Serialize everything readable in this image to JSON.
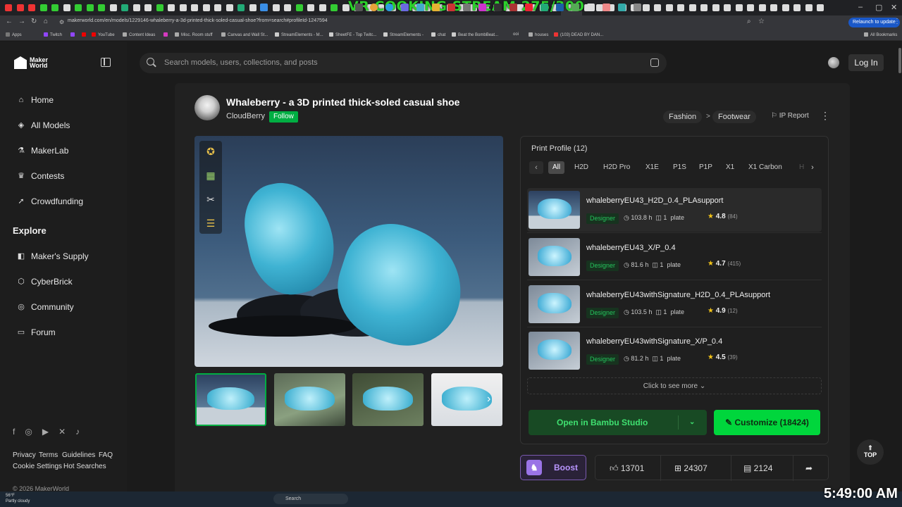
{
  "browser": {
    "stream_overlay": "VR COOKING STREAM 275/300",
    "url": "makerworld.com/en/models/1229146-whaleberry-a-3d-printed-thick-soled-casual-shoe?from=search#profileId-1247594",
    "relaunch_label": "Relaunch to update",
    "bookmarks": [
      "Apps",
      "Twitch",
      "YouTube",
      "Content Ideas",
      "Misc. Room stuff",
      "Canvas and Wall St...",
      "StreamElements - M...",
      "SheetFE - Top Twitc...",
      "StreamElements -",
      "chat",
      "Beat the BombBeat...",
      "ooi",
      "houses",
      "(103) DEAD BY DAN...",
      "All Bookmarks"
    ]
  },
  "sidebar": {
    "logo_line1": "Maker",
    "logo_line2": "World",
    "items": [
      {
        "label": "Home",
        "icon": "home-icon"
      },
      {
        "label": "All Models",
        "icon": "models-icon"
      },
      {
        "label": "MakerLab",
        "icon": "lab-icon"
      },
      {
        "label": "Contests",
        "icon": "trophy-icon"
      },
      {
        "label": "Crowdfunding",
        "icon": "rocket-icon"
      }
    ],
    "explore_heading": "Explore",
    "explore_items": [
      {
        "label": "Maker's Supply",
        "icon": "shopping-bag-icon"
      },
      {
        "label": "CyberBrick",
        "icon": "brick-icon"
      },
      {
        "label": "Community",
        "icon": "globe-icon"
      },
      {
        "label": "Forum",
        "icon": "forum-icon"
      }
    ],
    "footer_links": [
      "Privacy",
      "Terms",
      "Guidelines",
      "FAQ",
      "Cookie Settings",
      "Hot Searches"
    ],
    "copyright": "© 2026 MakerWorld"
  },
  "header": {
    "search_placeholder": "Search models, users, collections, and posts",
    "login_label": "Log In"
  },
  "model": {
    "title": "Whaleberry - a 3D printed thick-soled casual shoe",
    "author": "CloudBerry",
    "follow_label": "Follow",
    "breadcrumb": [
      "Fashion",
      "Footwear"
    ],
    "breadcrumb_separator": ">",
    "ip_report_label": "IP Report"
  },
  "print_profile": {
    "title": "Print Profile (12)",
    "chips": [
      "All",
      "H2D",
      "H2D Pro",
      "X1E",
      "P1S",
      "P1P",
      "X1",
      "X1 Carbon",
      "H"
    ],
    "profiles": [
      {
        "name": "whaleberryEU43_H2D_0.4_PLAsupport",
        "tag": "Designer",
        "time": "103.8 h",
        "plates": "1",
        "plate_label": "plate",
        "rating": "4.8",
        "count": "(84)"
      },
      {
        "name": "whaleberryEU43_X/P_0.4",
        "tag": "Designer",
        "time": "81.6 h",
        "plates": "1",
        "plate_label": "plate",
        "rating": "4.7",
        "count": "(415)"
      },
      {
        "name": "whaleberryEU43withSignature_H2D_0.4_PLAsupport",
        "tag": "Designer",
        "time": "103.5 h",
        "plates": "1",
        "plate_label": "plate",
        "rating": "4.9",
        "count": "(12)"
      },
      {
        "name": "whaleberryEU43withSignature_X/P_0.4",
        "tag": "Designer",
        "time": "81.2 h",
        "plates": "1",
        "plate_label": "plate",
        "rating": "4.5",
        "count": "(39)"
      }
    ],
    "click_more": "Click to see more",
    "open_label": "Open in Bambu Studio",
    "customize_label": "Customize  (18424)"
  },
  "actions": {
    "boost_label": "Boost",
    "likes": "13701",
    "collects": "24307",
    "comments": "2124"
  },
  "top_label": "TOP",
  "taskbar": {
    "weather_temp": "56°F",
    "weather_desc": "Partly cloudy",
    "search_label": "Search",
    "clock": "5:49:00 AM"
  },
  "colors": {
    "accent": "#00ae42",
    "customize": "#00d63c",
    "boost": "#9a74e6",
    "star": "#f5c518"
  }
}
